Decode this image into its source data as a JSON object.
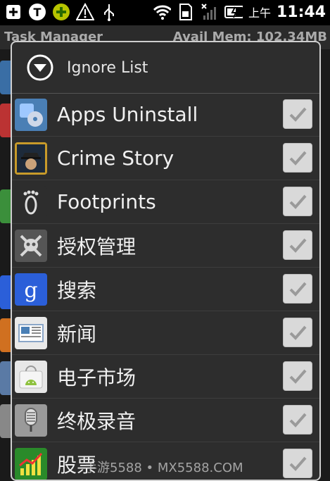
{
  "status_bar": {
    "ampm": "上午",
    "time": "11:44",
    "icons": [
      "plus-icon",
      "t-badge-icon",
      "plus-circle-icon",
      "warning-icon",
      "usb-icon",
      "wifi-icon",
      "sim-icon",
      "signal-off-icon",
      "battery-charging-icon"
    ]
  },
  "background_app": {
    "title": "Task Manager",
    "avail_mem": "Avail Mem: 102.34MB"
  },
  "dialog": {
    "title": "Ignore List",
    "header_icon": "chevron-down-circle-icon",
    "items": [
      {
        "label": "Apps Uninstall",
        "checked": true,
        "icon": "apps-uninstall-icon",
        "icon_color": "#4a7fb5"
      },
      {
        "label": "Crime Story",
        "checked": true,
        "icon": "crime-story-icon",
        "icon_color": "#c79a2a"
      },
      {
        "label": "Footprints",
        "checked": true,
        "icon": "footprints-icon",
        "icon_color": "#2d2d2d"
      },
      {
        "label": "授权管理",
        "checked": true,
        "icon": "skull-icon",
        "icon_color": "#555555"
      },
      {
        "label": "搜索",
        "checked": true,
        "icon": "google-g-icon",
        "icon_color": "#2b5fd9"
      },
      {
        "label": "新闻",
        "checked": true,
        "icon": "news-icon",
        "icon_color": "#e9e9e9"
      },
      {
        "label": "电子市场",
        "checked": true,
        "icon": "android-market-icon",
        "icon_color": "#e7e7e7"
      },
      {
        "label": "终极录音",
        "checked": true,
        "icon": "microphone-icon",
        "icon_color": "#9a9a9a"
      },
      {
        "label": "股票",
        "checked": true,
        "icon": "stocks-icon",
        "icon_color": "#2a8a2a"
      }
    ]
  },
  "watermark": "手游5588 • MX5588.COM"
}
